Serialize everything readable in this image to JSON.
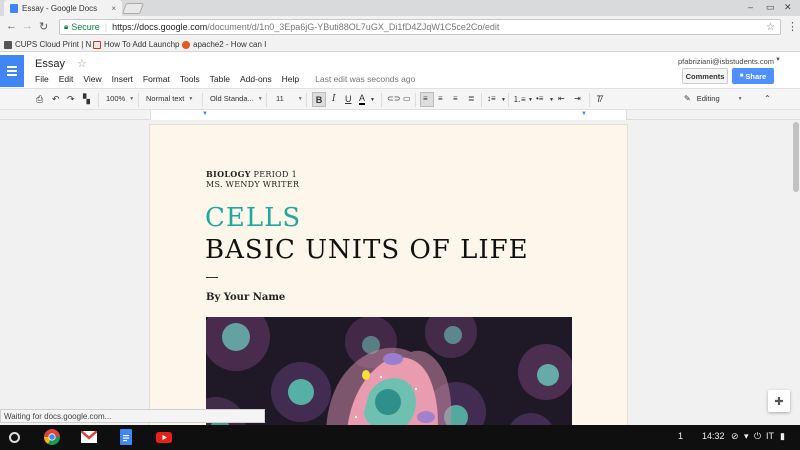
{
  "browser": {
    "tab_title": "Essay - Google Docs",
    "tab_close": "×",
    "window_min": "–",
    "window_max": "▭",
    "window_close": "✕",
    "secure_label": "Secure",
    "url_main": "https://docs.google.com",
    "url_rest": "/document/d/1n0_3Epa6jG-YButi88OL7uGX_Di1fD4ZJqW1C5ce2Co/edit",
    "bookmarks": [
      {
        "label": "CUPS Cloud Print | N",
        "icon": "printer-icon"
      },
      {
        "label": "How To Add Launchp",
        "icon": "bookmark-site-icon"
      },
      {
        "label": "apache2 - How can I",
        "icon": "askubuntu-icon"
      }
    ]
  },
  "docs": {
    "title": "Essay",
    "menu": [
      "File",
      "Edit",
      "View",
      "Insert",
      "Format",
      "Tools",
      "Table",
      "Add-ons",
      "Help"
    ],
    "last_edit": "Last edit was seconds ago",
    "user_email": "pfabriziani@isbstudents.com",
    "comments_label": "Comments",
    "share_label": "Share",
    "toolbar": {
      "zoom": "100%",
      "style": "Normal text",
      "font": "Old Standa...",
      "size": "11",
      "mode": "Editing"
    }
  },
  "document": {
    "subject_bold": "BIOLOGY",
    "subject_rest": " PERIOD 1",
    "teacher": "MS. WENDY WRITER",
    "heading1": "CELLS",
    "heading2": "BASIC UNITS OF LIFE",
    "byline": "By Your Name"
  },
  "status_text": "Waiting for docs.google.com...",
  "shelf": {
    "notification_count": "1",
    "time": "14:32",
    "locale": "IT"
  },
  "colors": {
    "accent_teal": "#1fa89c",
    "docs_blue": "#4285f4",
    "share_blue": "#4d90fe",
    "page_bg": "#fdf6ea"
  }
}
